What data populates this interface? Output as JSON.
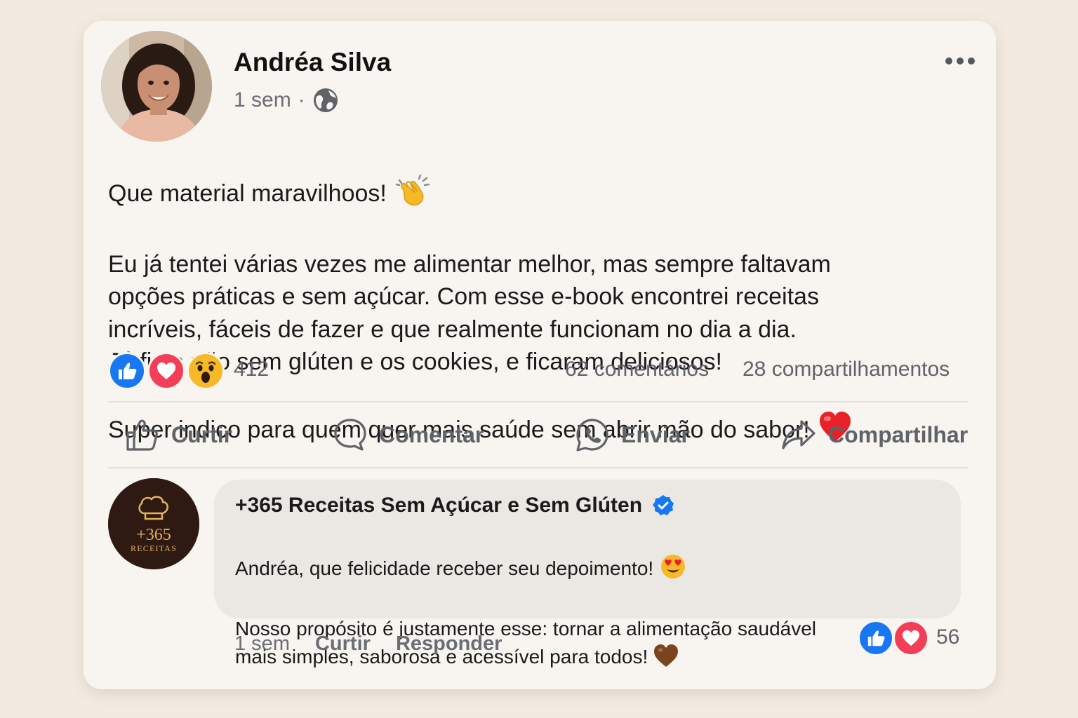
{
  "post": {
    "author": "Andréa Silva",
    "time": "1 sem",
    "separator": "·",
    "privacy_icon": "globe-icon",
    "text_line1": "Que material maravilhoos!",
    "text_line1_emoji": "clapping-hands-icon",
    "text_body": "Eu já tentei várias vezes me alimentar melhor, mas sempre faltavam\nopções práticas e sem açúcar. Com esse e-book encontrei receitas\nincríveis, fáceis de fazer e que realmente funcionam no dia a dia.\nJá fiz o pão sem glúten e os cookies, e ficaram deliciosos!",
    "text_last": "Super indico para quem quer mais saúde sem abrir mão do sabor!",
    "text_last_emoji": "red-heart-icon"
  },
  "stats": {
    "reactions": [
      "like-icon",
      "love-icon",
      "wow-icon"
    ],
    "reaction_count": "412",
    "comments": "62 comentários",
    "shares": "28 compartilhamentos"
  },
  "actions": {
    "like": "Curtir",
    "comment": "Comentar",
    "send": "Enviar",
    "share": "Compartilhar"
  },
  "comment": {
    "avatar_number": "+365",
    "avatar_word": "RECEITAS",
    "author": "+365 Receitas Sem Açúcar e Sem Glúten",
    "verified_icon": "verified-badge-icon",
    "line1": "Andréa, que felicidade receber seu depoimento!",
    "line1_emoji": "heart-eyes-icon",
    "line2": "Nosso propósito é justamente esse: tornar a alimentação saudável\nmais simples, saborosa e acessível para todos!",
    "line2_emoji": "brown-heart-icon",
    "time": "1 sem",
    "like": "Curtir",
    "reply": "Responder",
    "reaction_count": "56"
  },
  "colors": {
    "like_blue": "#1877f2",
    "love_red": "#f33e58",
    "wow_yellow": "#f7b928",
    "muted_text": "#5f6267",
    "card_bg": "#f8f5f1",
    "page_bg": "#f3ebe2",
    "bubble_bg": "#ebe7e3",
    "brand_dark": "#2e1a13",
    "brand_gold": "#e3b25c"
  }
}
